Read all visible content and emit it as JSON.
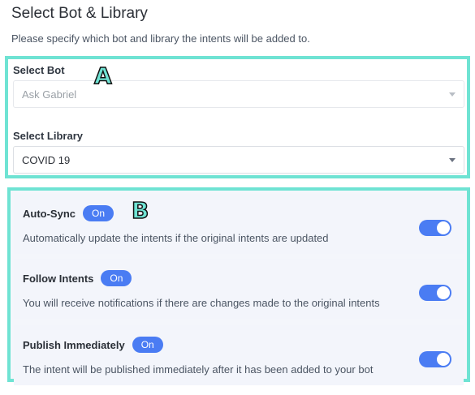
{
  "header": {
    "title": "Select Bot & Library",
    "subtitle": "Please specify which bot and library the intents will be added to."
  },
  "annotations": {
    "marker_a": "A",
    "marker_b": "B"
  },
  "bot": {
    "label": "Select Bot",
    "value": "Ask Gabriel",
    "disabled": true
  },
  "library": {
    "label": "Select Library",
    "value": "COVID 19",
    "disabled": false
  },
  "settings": [
    {
      "title": "Auto-Sync",
      "badge": "On",
      "description": "Automatically update the intents if the original intents are updated",
      "enabled": true
    },
    {
      "title": "Follow Intents",
      "badge": "On",
      "description": "You will receive notifications if there are changes made to the original intents",
      "enabled": true
    },
    {
      "title": "Publish Immediately",
      "badge": "On",
      "description": "The intent will be published immediately after it has been added to your bot",
      "enabled": true
    }
  ],
  "colors": {
    "accent": "#4a7cf3",
    "highlight": "#6fe3d3"
  }
}
